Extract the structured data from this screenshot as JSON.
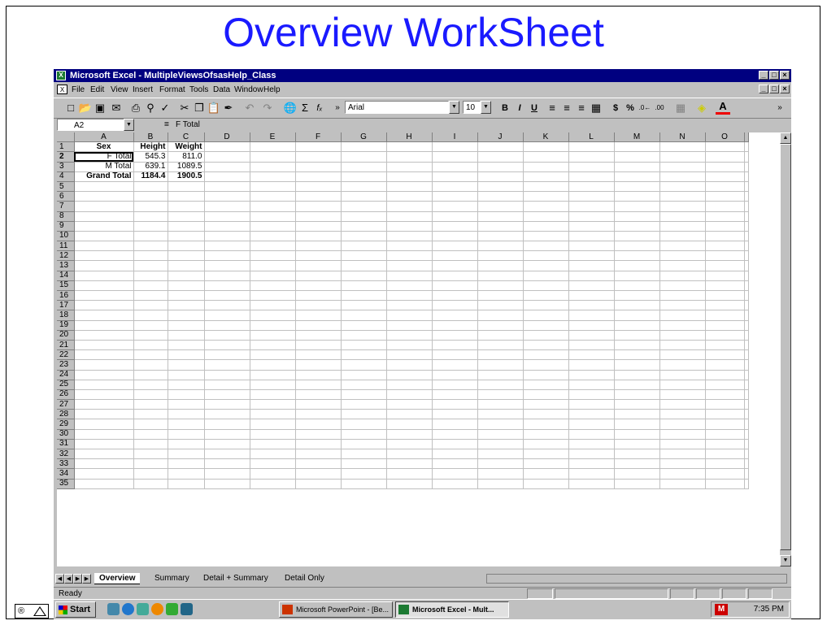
{
  "slide": {
    "title": "Overview WorkSheet"
  },
  "window": {
    "title": "Microsoft Excel - MultipleViewsOfsasHelp_Class",
    "controls": [
      "_",
      "□",
      "×"
    ]
  },
  "menu": {
    "items": [
      "File",
      "Edit",
      "View",
      "Insert",
      "Format",
      "Tools",
      "Data",
      "Window",
      "Help"
    ]
  },
  "toolbar": {
    "font_name": "Arial",
    "font_size": "10",
    "icons": [
      "new-icon",
      "open-icon",
      "save-icon",
      "email-icon",
      "print-icon",
      "print-preview-icon",
      "spelling-icon",
      "cut-icon",
      "copy-icon",
      "paste-icon",
      "format-painter-icon",
      "undo-icon",
      "redo-icon",
      "hyperlink-icon",
      "autosum-icon",
      "function-icon",
      "bold-icon",
      "italic-icon",
      "underline-icon",
      "align-left-icon",
      "align-center-icon",
      "align-right-icon",
      "merge-center-icon",
      "currency-icon",
      "percent-icon",
      "increase-decimal-icon",
      "decrease-decimal-icon",
      "borders-icon",
      "fill-color-icon",
      "font-color-icon"
    ]
  },
  "formula_bar": {
    "name_box": "A2",
    "equals": "=",
    "formula": "F Total"
  },
  "grid": {
    "columns": [
      "A",
      "B",
      "C",
      "D",
      "E",
      "F",
      "G",
      "H",
      "I",
      "J",
      "K",
      "L",
      "M",
      "N",
      "O"
    ],
    "row_numbers": [
      "1",
      "2",
      "3",
      "4",
      "5",
      "6",
      "7",
      "8",
      "9",
      "10",
      "11",
      "12",
      "13",
      "14",
      "15",
      "16",
      "17",
      "18",
      "19",
      "20",
      "21",
      "22",
      "23",
      "24",
      "25",
      "26",
      "27",
      "28",
      "29",
      "30",
      "31",
      "32",
      "33",
      "34",
      "35"
    ],
    "data": [
      [
        "Sex",
        "Height",
        "Weight"
      ],
      [
        "F Total",
        "545.3",
        "811.0"
      ],
      [
        "M Total",
        "639.1",
        "1089.5"
      ],
      [
        "Grand Total",
        "1184.4",
        "1900.5"
      ]
    ]
  },
  "sheet_tabs": [
    "Overview",
    "Summary",
    "Detail + Summary",
    "Detail Only"
  ],
  "status": {
    "text": "Ready"
  },
  "taskbar": {
    "start_label": "Start",
    "tasks": [
      "Microsoft PowerPoint - [Be...",
      "Microsoft Excel - Mult..."
    ],
    "clock": "7:35 PM"
  },
  "corner": {
    "icon_text": "®"
  }
}
